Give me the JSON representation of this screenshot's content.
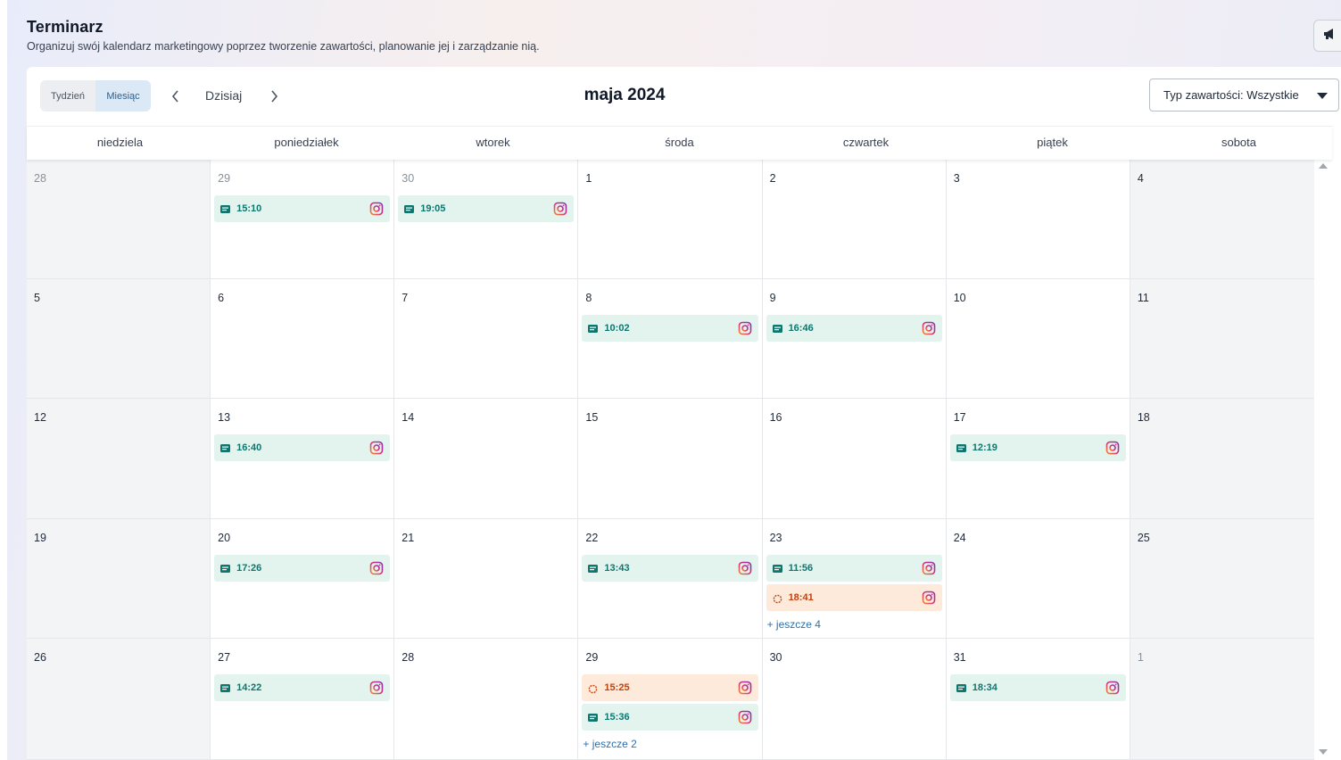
{
  "header": {
    "title": "Terminarz",
    "subtitle": "Organizuj swój kalendarz marketingowy poprzez tworzenie zawartości, planowanie jej i zarządzanie nią."
  },
  "toolbar": {
    "week_label": "Tydzień",
    "month_label": "Miesiąc",
    "today_label": "Dzisiaj",
    "month_title": "maja 2024",
    "filter_label": "Typ zawartości: Wszystkie"
  },
  "weekdays": [
    "niedziela",
    "poniedziałek",
    "wtorek",
    "środa",
    "czwartek",
    "piątek",
    "sobota"
  ],
  "weeks": [
    [
      {
        "day": "28",
        "muted": true,
        "events": []
      },
      {
        "day": "29",
        "muted": true,
        "events": [
          {
            "time": "15:10",
            "status": "published"
          }
        ]
      },
      {
        "day": "30",
        "muted": true,
        "events": [
          {
            "time": "19:05",
            "status": "published"
          }
        ]
      },
      {
        "day": "1",
        "events": []
      },
      {
        "day": "2",
        "events": []
      },
      {
        "day": "3",
        "events": []
      },
      {
        "day": "4",
        "events": []
      }
    ],
    [
      {
        "day": "5",
        "events": []
      },
      {
        "day": "6",
        "events": []
      },
      {
        "day": "7",
        "events": []
      },
      {
        "day": "8",
        "events": [
          {
            "time": "10:02",
            "status": "published"
          }
        ]
      },
      {
        "day": "9",
        "events": [
          {
            "time": "16:46",
            "status": "published"
          }
        ]
      },
      {
        "day": "10",
        "events": []
      },
      {
        "day": "11",
        "events": []
      }
    ],
    [
      {
        "day": "12",
        "events": []
      },
      {
        "day": "13",
        "events": [
          {
            "time": "16:40",
            "status": "published"
          }
        ]
      },
      {
        "day": "14",
        "events": []
      },
      {
        "day": "15",
        "events": []
      },
      {
        "day": "16",
        "events": []
      },
      {
        "day": "17",
        "events": [
          {
            "time": "12:19",
            "status": "published"
          }
        ]
      },
      {
        "day": "18",
        "events": []
      }
    ],
    [
      {
        "day": "19",
        "events": []
      },
      {
        "day": "20",
        "events": [
          {
            "time": "17:26",
            "status": "published"
          }
        ]
      },
      {
        "day": "21",
        "events": []
      },
      {
        "day": "22",
        "events": [
          {
            "time": "13:43",
            "status": "published"
          }
        ]
      },
      {
        "day": "23",
        "events": [
          {
            "time": "11:56",
            "status": "published"
          },
          {
            "time": "18:41",
            "status": "pending"
          }
        ],
        "more": "+ jeszcze 4"
      },
      {
        "day": "24",
        "events": []
      },
      {
        "day": "25",
        "events": []
      }
    ],
    [
      {
        "day": "26",
        "events": []
      },
      {
        "day": "27",
        "events": [
          {
            "time": "14:22",
            "status": "published"
          }
        ]
      },
      {
        "day": "28",
        "events": []
      },
      {
        "day": "29",
        "events": [
          {
            "time": "15:25",
            "status": "pending"
          },
          {
            "time": "15:36",
            "status": "published"
          }
        ],
        "more": "+ jeszcze 2"
      },
      {
        "day": "30",
        "events": []
      },
      {
        "day": "31",
        "events": [
          {
            "time": "18:34",
            "status": "published"
          }
        ]
      },
      {
        "day": "1",
        "muted": true,
        "events": []
      }
    ]
  ],
  "icons": {
    "published": "message-icon",
    "pending": "spinner-icon",
    "network": "instagram-icon",
    "announce": "megaphone-icon"
  },
  "colors": {
    "published_bg": "#e3f3ee",
    "published_fg": "#0f766e",
    "pending_bg": "#fdeadb",
    "pending_fg": "#c2410c",
    "active_view": "#dbe9f6"
  }
}
